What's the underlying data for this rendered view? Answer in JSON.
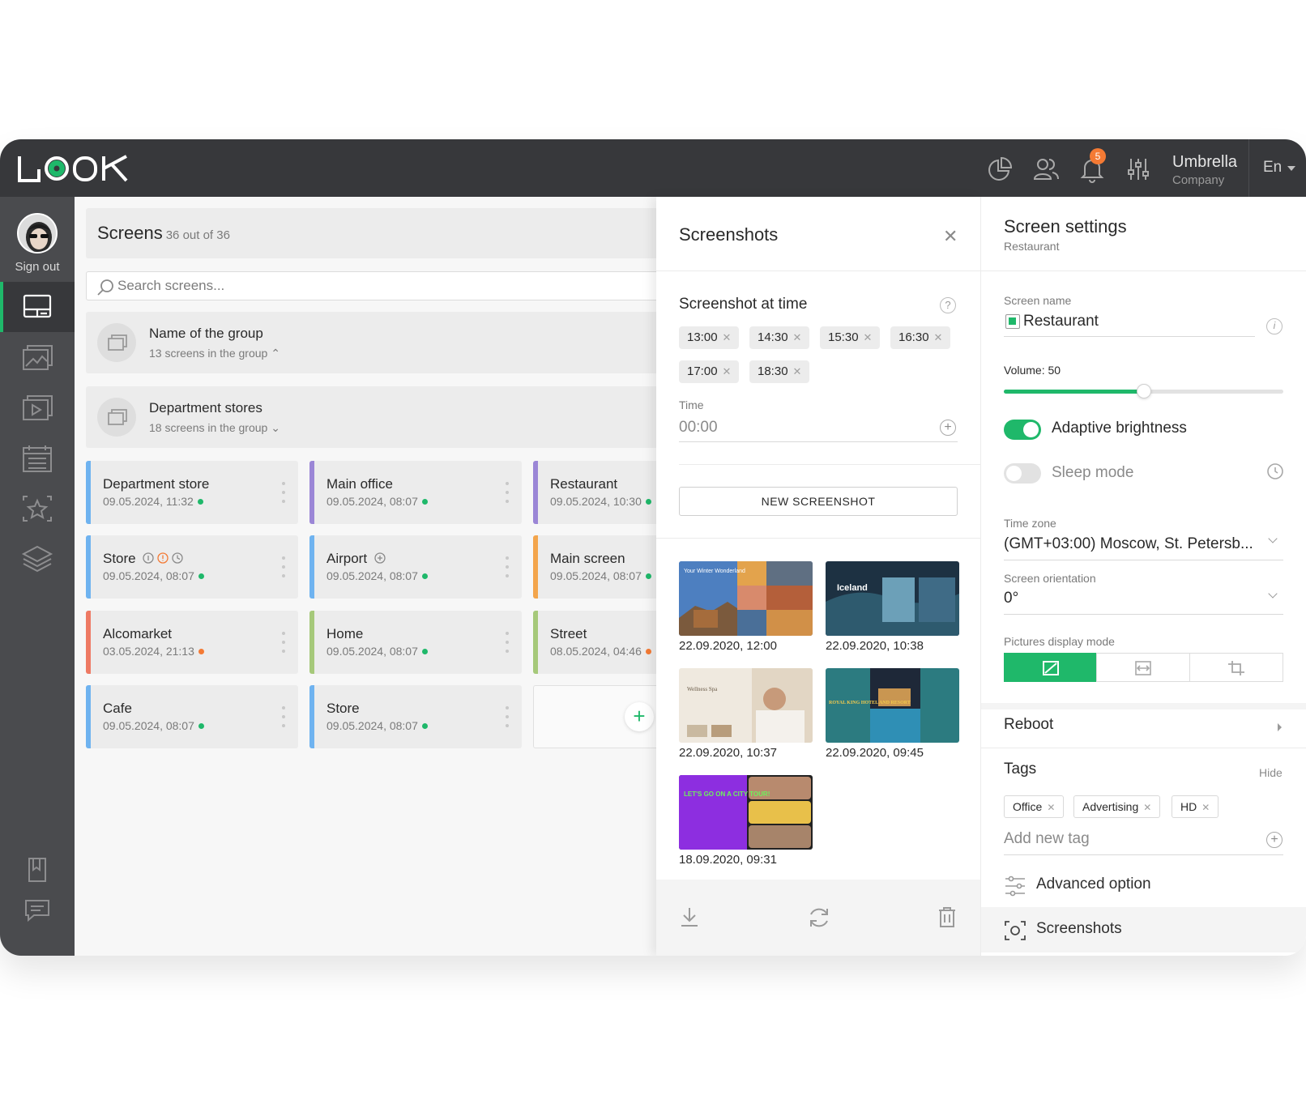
{
  "header": {
    "logo_text": "LOOK",
    "notification_count": "5",
    "company_name": "Umbrella",
    "company_sub": "Company",
    "language": "En"
  },
  "sidebar": {
    "signout_label": "Sign out",
    "items": [
      "screens-icon",
      "gallery-icon",
      "playlist-icon",
      "schedule-icon",
      "favorites-icon",
      "layers-icon",
      "guide-icon",
      "chat-icon"
    ]
  },
  "screens": {
    "title": "Screens",
    "count": "36 out of 36",
    "search_placeholder": "Search screens...",
    "groups": [
      {
        "name": "Name of the group",
        "sub": "13 screens in the group"
      },
      {
        "name": "Department stores",
        "sub": "18 screens in the group"
      }
    ],
    "cards": [
      {
        "name": "Department store",
        "date": "09.05.2024, 11:32",
        "color": "#6fb3f0",
        "status": "#1fb86a"
      },
      {
        "name": "Main office",
        "date": "09.05.2024, 08:07",
        "color": "#9b86d6",
        "status": "#1fb86a"
      },
      {
        "name": "Restaurant",
        "date": "09.05.2024, 10:30",
        "color": "#9b86d6",
        "status": "#1fb86a"
      },
      {
        "name": "Store",
        "date": "09.05.2024, 08:07",
        "color": "#6fb3f0",
        "status": "#1fb86a"
      },
      {
        "name": "Airport",
        "date": "09.05.2024, 08:07",
        "color": "#6fb3f0",
        "status": "#1fb86a"
      },
      {
        "name": "Main screen",
        "date": "09.05.2024, 08:07",
        "color": "#f3a54c",
        "status": "#1fb86a"
      },
      {
        "name": "Alcomarket",
        "date": "03.05.2024, 21:13",
        "color": "#ee7a64",
        "status": "#f47a34"
      },
      {
        "name": "Home",
        "date": "09.05.2024, 08:07",
        "color": "#a6c97a",
        "status": "#1fb86a"
      },
      {
        "name": "Street",
        "date": "08.05.2024, 04:46",
        "color": "#a6c97a",
        "status": "#f47a34"
      },
      {
        "name": "Cafe",
        "date": "09.05.2024, 08:07",
        "color": "#6fb3f0",
        "status": "#1fb86a"
      },
      {
        "name": "Store",
        "date": "09.05.2024, 08:07",
        "color": "#6fb3f0",
        "status": "#1fb86a"
      }
    ]
  },
  "screenshots": {
    "title": "Screenshots",
    "section_title": "Screenshot at time",
    "times": [
      "13:00",
      "14:30",
      "15:30",
      "16:30",
      "17:00",
      "18:30"
    ],
    "time_label": "Time",
    "time_value": "00:00",
    "new_button": "NEW SCREENSHOT",
    "items": [
      {
        "date": "22.09.2020, 12:00",
        "caption": "Your Winter Wonderland"
      },
      {
        "date": "22.09.2020, 10:38",
        "caption": "Iceland"
      },
      {
        "date": "22.09.2020, 10:37",
        "caption": "Wellness Spa"
      },
      {
        "date": "22.09.2020, 09:45",
        "caption": "ROYAL KING HOTEL AND RESORT"
      },
      {
        "date": "18.09.2020, 09:31",
        "caption": "LET'S GO ON A CITY TOUR!"
      }
    ]
  },
  "settings": {
    "title": "Screen settings",
    "subtitle": "Restaurant",
    "screen_name_label": "Screen name",
    "screen_name": "Restaurant",
    "volume_label": "Volume: 50",
    "volume": 0.5,
    "adaptive_label": "Adaptive brightness",
    "adaptive_on": true,
    "sleep_label": "Sleep mode",
    "sleep_on": false,
    "timezone_label": "Time zone",
    "timezone": "(GMT+03:00) Moscow, St. Petersb...",
    "orientation_label": "Screen orientation",
    "orientation": "0°",
    "display_mode_label": "Pictures display mode",
    "reboot": "Reboot",
    "tags_title": "Tags",
    "hide": "Hide",
    "tags": [
      "Office",
      "Advertising",
      "HD"
    ],
    "add_tag_placeholder": "Add new tag",
    "advanced": "Advanced option",
    "screenshots": "Screenshots"
  },
  "colors": {
    "accent": "#1fb86a",
    "topbar": "#37383b",
    "sidebar": "#4a4b4e",
    "alert": "#f47a34"
  }
}
